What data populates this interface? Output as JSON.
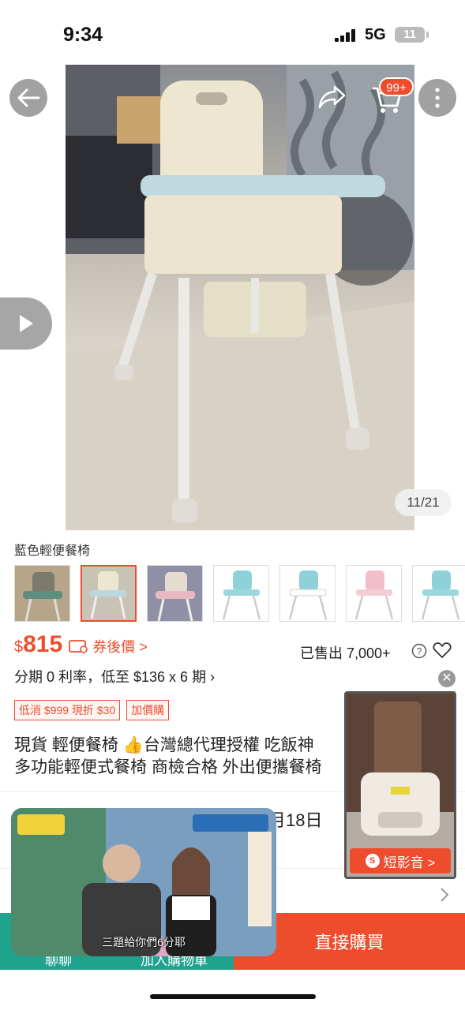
{
  "status": {
    "time": "9:34",
    "network": "5G",
    "battery": "11"
  },
  "header": {
    "cart_badge": "99+"
  },
  "gallery": {
    "counter": "11/21"
  },
  "variant": {
    "label": "藍色輕便餐椅",
    "thumbnails": [
      {
        "name": "gray-chair"
      },
      {
        "name": "blue-chair-photo"
      },
      {
        "name": "pink-chair-photo"
      },
      {
        "name": "blue-chair"
      },
      {
        "name": "blue-chair-alt"
      },
      {
        "name": "pink-chair"
      },
      {
        "name": "blue-chair-2"
      }
    ]
  },
  "price": {
    "symbol": "$",
    "value": "815",
    "after_coupon": "券後價 >"
  },
  "sold": "已售出 7,000+",
  "installment": "分期 0 利率，低至 $136 x 6 期 ›",
  "promos": [
    "低消 $999 現折 $30",
    "加價購"
  ],
  "title": {
    "line1_a": "現貨 輕便餐椅 ",
    "emoji": "👍",
    "line1_b": "台灣總代理授權 吃飯神",
    "line2": "多功能輕便式餐椅 商檢合格 外出便攜餐椅"
  },
  "delivery_date": "月18日",
  "bottom_bar": {
    "chat": "聊聊",
    "add_cart": "加入購物車",
    "buy_now": "直接購買"
  },
  "live": {
    "caption": "三題給你們6分耶"
  },
  "short_video": {
    "label": "短影音 >"
  },
  "colors": {
    "accent": "#ee4d2d",
    "teal": "#1fa28e"
  }
}
